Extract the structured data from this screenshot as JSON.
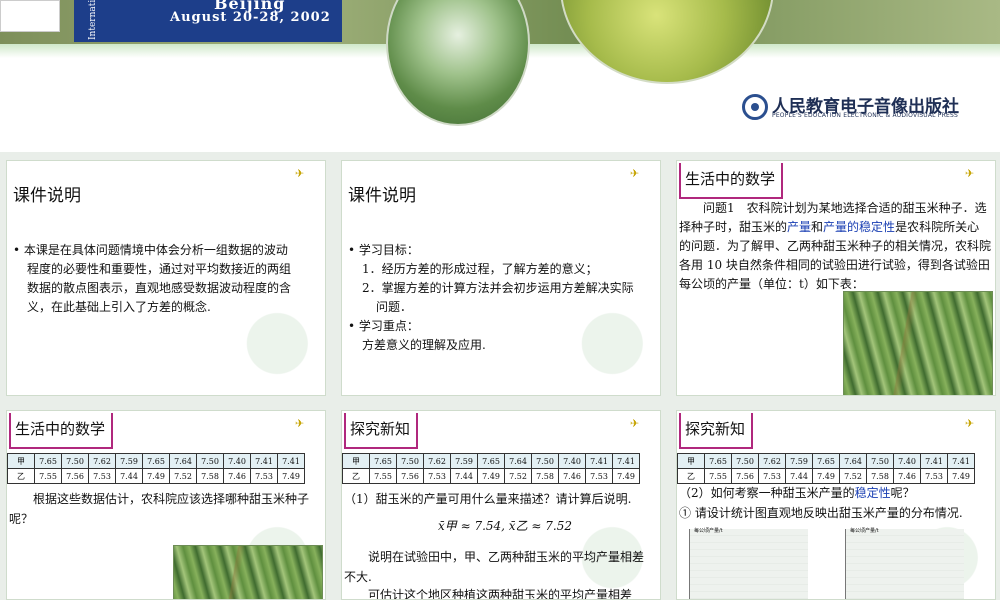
{
  "header": {
    "banner_city": "Beijing",
    "banner_dates": "August 20-28, 2002",
    "banner_vertical": "Internati",
    "publisher_name": "人民教育电子音像出版社",
    "publisher_en": "PEOPLE'S EDUCATION ELECTRONIC & AUDIOVISUAL PRESS"
  },
  "slides": [
    {
      "title": "课件说明",
      "lines": [
        "• 本课是在具体问题情境中体会分析一组数据的波动",
        "程度的必要性和重要性，通过对平均数接近的两组",
        "数据的散点图表示，直观地感受数据波动程度的含",
        "义，在此基础上引入了方差的概念."
      ]
    },
    {
      "title": "课件说明",
      "lines": [
        "• 学习目标：",
        "1．经历方差的形成过程，了解方差的意义；",
        "2．掌握方差的计算方法并会初步运用方差解决实际",
        "问题．",
        "• 学习重点：",
        "方差意义的理解及应用."
      ]
    },
    {
      "title": "生活中的数学",
      "para_a": "问题1　农科院计划为某地选择合适的甜玉米种子．选择种子时，甜玉米的",
      "hl1": "产量",
      "para_b": "和",
      "hl2": "产量的稳定性",
      "para_c": "是农科院所关心的问题．为了解甲、乙两种甜玉米种子的相关情况，农科院各用 10 块自然条件相同的试验田进行试验，得到各试验田每公顷的产量（单位：t）如下表："
    },
    {
      "title": "生活中的数学",
      "para": "根据这些数据估计，农科院应该选择哪种甜玉米种子呢？"
    },
    {
      "title": "探究新知",
      "q1": "（1）甜玉米的产量可用什么量来描述？请计算后说明.",
      "formula": "x̄甲 ≈ 7.54,  x̄乙 ≈ 7.52",
      "p1": "说明在试验田中，甲、乙两种甜玉米的平均产量相差不大.",
      "p2": "可估计这个地区种植这两种甜玉米的平均产量相差"
    },
    {
      "title": "探究新知",
      "q2a": "（2）如何考察一种甜玉米产量的",
      "q2hl": "稳定性",
      "q2b": "呢？",
      "q3": "① 请设计统计图直观地反映出甜玉米产量的分布情况.",
      "chart_label": "每公顷产量/t"
    }
  ],
  "table": {
    "row1": [
      "甲",
      "7.65",
      "7.50",
      "7.62",
      "7.59",
      "7.65",
      "7.64",
      "7.50",
      "7.40",
      "7.41",
      "7.41"
    ],
    "row2": [
      "乙",
      "7.55",
      "7.56",
      "7.53",
      "7.44",
      "7.49",
      "7.52",
      "7.58",
      "7.46",
      "7.53",
      "7.49"
    ]
  }
}
